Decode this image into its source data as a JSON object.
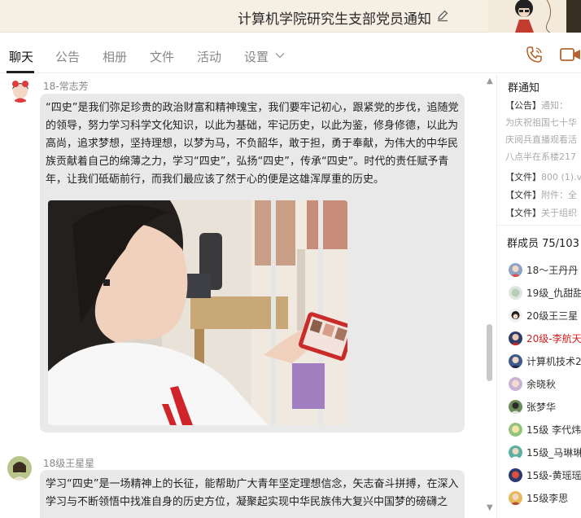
{
  "window": {
    "title": "计算机学院研究生支部党员通知"
  },
  "tabs": [
    {
      "label": "聊天",
      "active": true
    },
    {
      "label": "公告",
      "active": false
    },
    {
      "label": "相册",
      "active": false
    },
    {
      "label": "文件",
      "active": false
    },
    {
      "label": "活动",
      "active": false
    },
    {
      "label": "设置",
      "active": false
    }
  ],
  "messages": [
    {
      "sender": "18-常志芳",
      "text": "“四史”是我们弥足珍贵的政治财富和精神瑰宝，我们要牢记初心，跟紧党的步伐，追随党的领导，努力学习科学文化知识，以此为基础，牢记历史，以此为鉴，修身修德，以此为高尚，追求梦想，坚持理想，以梦为马，不负韶华，敢于担，勇于奉献，为伟大的中华民族贡献着自己的绵薄之力，学习“四史”，弘扬“四史”，传承“四史”。时代的责任赋予青年，让我们砥砺前行，而我们最应该了然于心的便是这雄浑厚重的历史。"
    },
    {
      "sender": "18级王星星",
      "text": "学习“四史”是一场精神上的长征，能帮助广大青年坚定理想信念，矢志奋斗拼搏，在深入学习与不断领悟中找准自身的历史方位，凝聚起实现中华民族伟大复兴中国梦的磅礴之"
    }
  ],
  "panel": {
    "notice_title": "群通知",
    "notices": [
      {
        "tag": "【公告】",
        "text": "通知："
      },
      {
        "tag": "",
        "text": "为庆祝祖国七十华"
      },
      {
        "tag": "",
        "text": "庆阅兵直播观看活"
      },
      {
        "tag": "",
        "text": "八点半在系楼217"
      },
      {
        "tag": "【文件】",
        "text": "800 (1).v"
      },
      {
        "tag": "【文件】",
        "text": "附件：全"
      },
      {
        "tag": "【文件】",
        "text": "关于组织"
      }
    ],
    "members_title": "群成员 75/103",
    "members": [
      {
        "name": "18～王丹丹",
        "highlight": false
      },
      {
        "name": "19级_仇甜甜",
        "highlight": false
      },
      {
        "name": "20级王三星",
        "highlight": false
      },
      {
        "name": "20级-李航天",
        "highlight": true
      },
      {
        "name": "计算机技术2",
        "highlight": false
      },
      {
        "name": "余晓秋",
        "highlight": false
      },
      {
        "name": "张梦华",
        "highlight": false
      },
      {
        "name": "15级 李代炜",
        "highlight": false
      },
      {
        "name": "15级_马琳琳",
        "highlight": false
      },
      {
        "name": "15级-黄瑶瑶",
        "highlight": false
      },
      {
        "name": "15级李思",
        "highlight": false
      }
    ]
  },
  "colors": {
    "title_bg": "#f6efe4",
    "bubble_bg": "#e9e9e9",
    "highlight_member": "#d21f1f",
    "call_icon": "#b5642d"
  },
  "icons": {
    "edit": "pencil-edit-icon",
    "phone": "phone-call-icon",
    "video": "video-call-icon",
    "dropdown": "chevron-down-icon"
  }
}
